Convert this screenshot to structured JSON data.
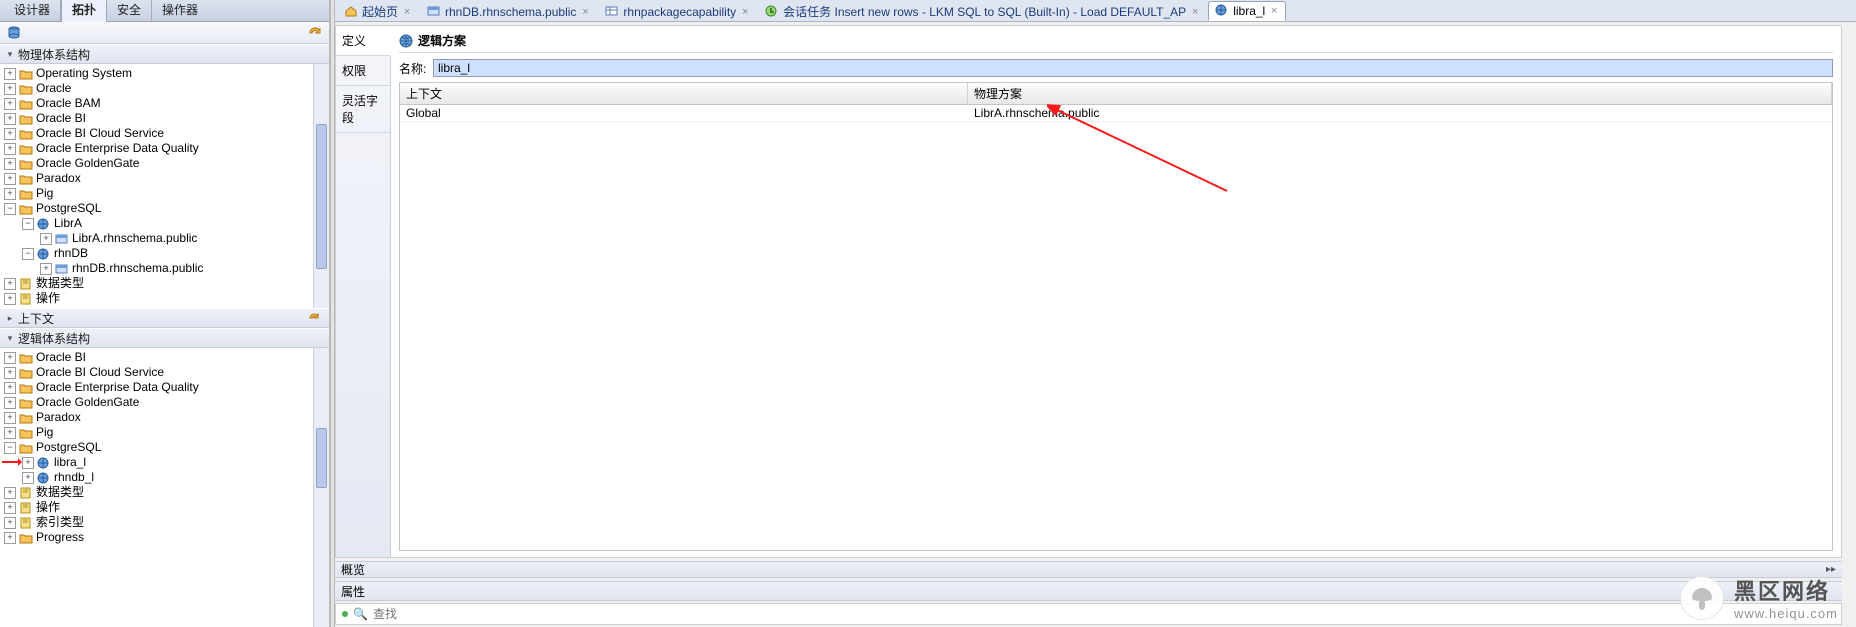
{
  "topTabs": {
    "designer": "设计器",
    "topology": "拓扑",
    "security": "安全",
    "operator": "操作器"
  },
  "accordion": {
    "physical": "物理体系结构",
    "context": "上下文",
    "logical": "逻辑体系结构"
  },
  "physicalTree": {
    "items": [
      {
        "label": "Operating System"
      },
      {
        "label": "Oracle"
      },
      {
        "label": "Oracle BAM"
      },
      {
        "label": "Oracle BI"
      },
      {
        "label": "Oracle BI Cloud Service"
      },
      {
        "label": "Oracle Enterprise Data Quality"
      },
      {
        "label": "Oracle GoldenGate"
      },
      {
        "label": "Paradox"
      },
      {
        "label": "Pig"
      },
      {
        "label": "PostgreSQL",
        "expanded": true,
        "children": [
          {
            "label": "LibrA",
            "icon": "globe",
            "expanded": true,
            "children": [
              {
                "label": "LibrA.rhnschema.public",
                "icon": "glyph"
              }
            ]
          },
          {
            "label": "rhnDB",
            "icon": "globe",
            "expanded": true,
            "children": [
              {
                "label": "rhnDB.rhnschema.public",
                "icon": "glyph"
              }
            ]
          }
        ]
      },
      {
        "label": "数据类型",
        "icon": "book"
      },
      {
        "label": "操作",
        "icon": "book"
      }
    ]
  },
  "logicalTree": {
    "items": [
      {
        "label": "Oracle BI"
      },
      {
        "label": "Oracle BI Cloud Service"
      },
      {
        "label": "Oracle Enterprise Data Quality"
      },
      {
        "label": "Oracle GoldenGate"
      },
      {
        "label": "Paradox"
      },
      {
        "label": "Pig"
      },
      {
        "label": "PostgreSQL",
        "expanded": true,
        "children": [
          {
            "label": "libra_l",
            "icon": "globe",
            "marker": true
          },
          {
            "label": "rhndb_l",
            "icon": "globe"
          }
        ]
      },
      {
        "label": "数据类型",
        "icon": "book"
      },
      {
        "label": "操作",
        "icon": "book"
      },
      {
        "label": "索引类型",
        "icon": "book"
      },
      {
        "label": "Progress"
      }
    ]
  },
  "editorTabs": [
    {
      "label": "起始页",
      "icon": "house"
    },
    {
      "label": "rhnDB.rhnschema.public",
      "icon": "glyph"
    },
    {
      "label": "rhnpackagecapability",
      "icon": "table"
    },
    {
      "label": "会话任务 Insert new rows - LKM SQL to SQL (Built-In) - Load DEFAULT_AP",
      "icon": "task"
    },
    {
      "label": "libra_l",
      "icon": "globe",
      "active": true
    }
  ],
  "sideTabs": {
    "def": "定义",
    "perm": "权限",
    "flex": "灵活字段"
  },
  "form": {
    "title": "逻辑方案",
    "nameLabel": "名称:",
    "nameValue": "libra_l",
    "col1": "上下文",
    "col2": "物理方案",
    "row1_c1": "Global",
    "row1_c2": "LibrA.rhnschema.public"
  },
  "strips": {
    "preview": "概览",
    "props": "属性"
  },
  "search": {
    "placeholder": "查找",
    "iconGlyph": "🔍"
  },
  "watermark": {
    "line1": "黑区网络",
    "line2": "www.heiqu.com"
  }
}
